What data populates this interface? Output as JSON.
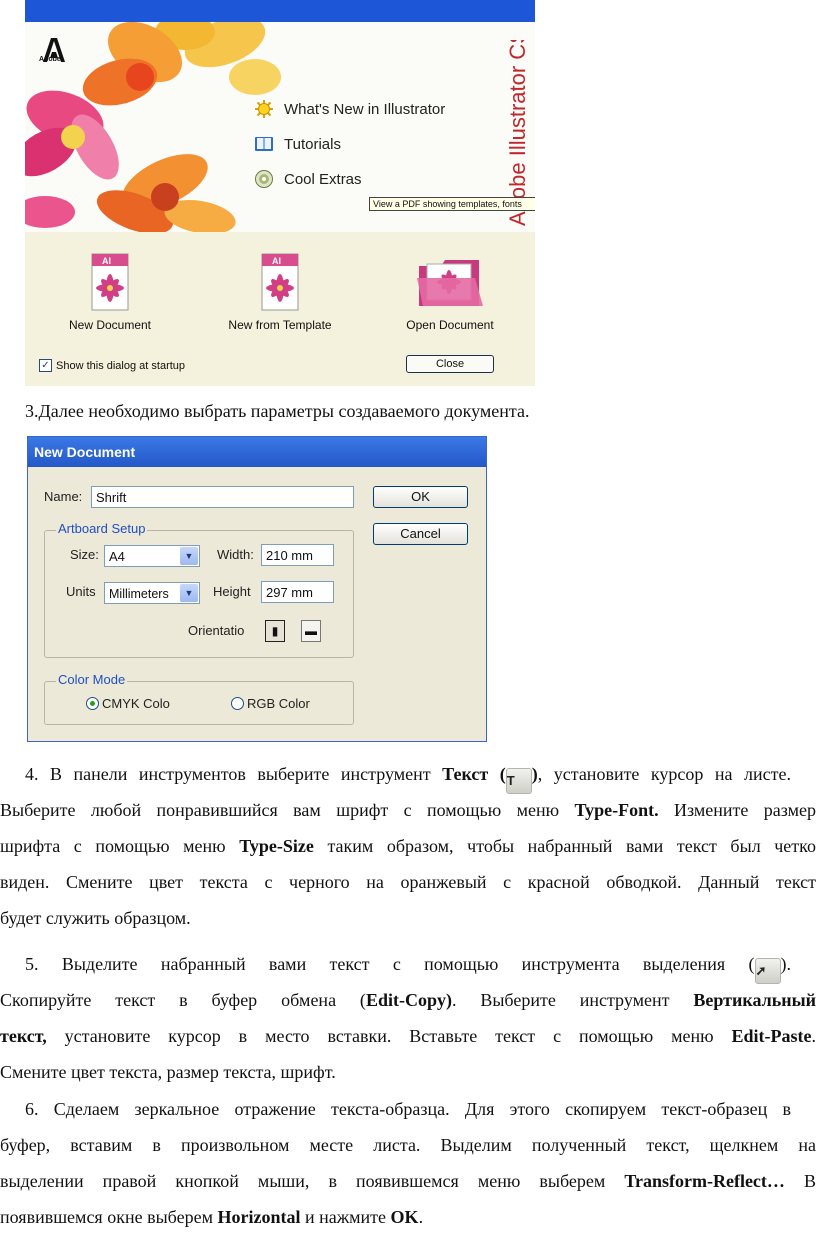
{
  "welcome": {
    "adobe_logo_text": "Adobe",
    "brand_vertical_text": "Adobe Illustrator CS",
    "menu": [
      {
        "label": "What's New in Illustrator",
        "icon": "sun-icon"
      },
      {
        "label": "Tutorials",
        "icon": "book-icon"
      },
      {
        "label": "Cool Extras",
        "icon": "cd-icon"
      }
    ],
    "tooltip": "View a PDF showing templates, fonts",
    "tiles": [
      {
        "label": "New Document",
        "icon": "ai-document-icon"
      },
      {
        "label": "New from Template",
        "icon": "ai-template-icon"
      },
      {
        "label": "Open Document",
        "icon": "folder-icon"
      }
    ],
    "show_at_startup_label": "Show this dialog at startup",
    "show_at_startup_checked": true,
    "close_label": "Close"
  },
  "paragraphs": {
    "p3": "3.Далее необходимо выбрать параметры создаваемого документа.",
    "p4": {
      "line1_a": "4. В панели инструментов выберите инструмент ",
      "line1_b": "Текст (",
      "line1_icon": "T",
      "line1_c": ")",
      "line1_d": ", установите курсор на листе.",
      "line2_a": "Выберите любой понравившийся вам шрифт с помощью меню ",
      "line2_b": "Type-Font.",
      "line2_c": " Измените размер",
      "line3_a": "шрифта с помощью меню ",
      "line3_b": "Type-Size",
      "line3_c": " таким образом, чтобы набранный вами текст был четко",
      "line4": "виден. Смените цвет текста с черного на оранжевый с красной обводкой. Данный текст",
      "line5": "будет служить образцом."
    },
    "p5": {
      "line1_a": "5. Выделите набранный вами текст с помощью инструмента выделения (",
      "line1_c": ").",
      "line2_a": "Скопируйте текст в буфер обмена (",
      "line2_b": "Edit-Copy)",
      "line2_c": ". Выберите инструмент ",
      "line2_d": "Вертикальный",
      "line3_a": "текст,",
      "line3_b": " установите курсор в место вставки. Вставьте текст с помощью меню ",
      "line3_c": "Edit-Paste",
      "line3_d": ".",
      "line4": "Смените цвет текста, размер текста, шрифт."
    },
    "p6": {
      "line1": "6. Сделаем зеркальное отражение текста-образца. Для этого скопируем текст-образец в",
      "line2": "буфер, вставим в произвольном месте листа. Выделим полученный текст, щелкнем на",
      "line3_a": "выделении правой кнопкой мыши, в появившемся меню выберем ",
      "line3_b": "Transform-Reflect…",
      "line3_c": " В",
      "line4_a": "появившемся окне выберем ",
      "line4_b": "Horizontal",
      "line4_c": " и нажмите ",
      "line4_d": "OK",
      "line4_e": "."
    }
  },
  "new_document": {
    "title": "New Document",
    "name_label": "Name:",
    "name_value": "Shrift",
    "ok_label": "OK",
    "cancel_label": "Cancel",
    "artboard_group": "Artboard Setup",
    "size_label": "Size:",
    "size_value": "A4",
    "width_label": "Width:",
    "width_value": "210 mm",
    "units_label": "Units",
    "units_value": "Millimeters",
    "height_label": "Height",
    "height_value": "297 mm",
    "orientation_label": "Orientatio",
    "color_group": "Color Mode",
    "cmyk_label": "CMYK Colo",
    "rgb_label": "RGB Color",
    "selected_color_mode": "CMYK"
  }
}
